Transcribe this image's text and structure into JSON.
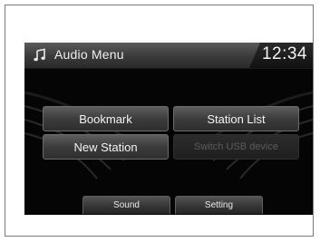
{
  "header": {
    "title": "Audio Menu",
    "clock": "12:34",
    "icon": "music-note-icon"
  },
  "menu": {
    "bookmark": "Bookmark",
    "station_list": "Station List",
    "new_station": "New Station",
    "switch_usb": "Switch USB device"
  },
  "tabs": {
    "sound": "Sound",
    "setting": "Setting"
  },
  "colors": {
    "screen_bg": "#050505",
    "header_bg": "#4a4a4a",
    "button_bg": "#4a4a4a",
    "button_text": "#f4f4f4",
    "disabled_text": "#5c5c5c"
  }
}
